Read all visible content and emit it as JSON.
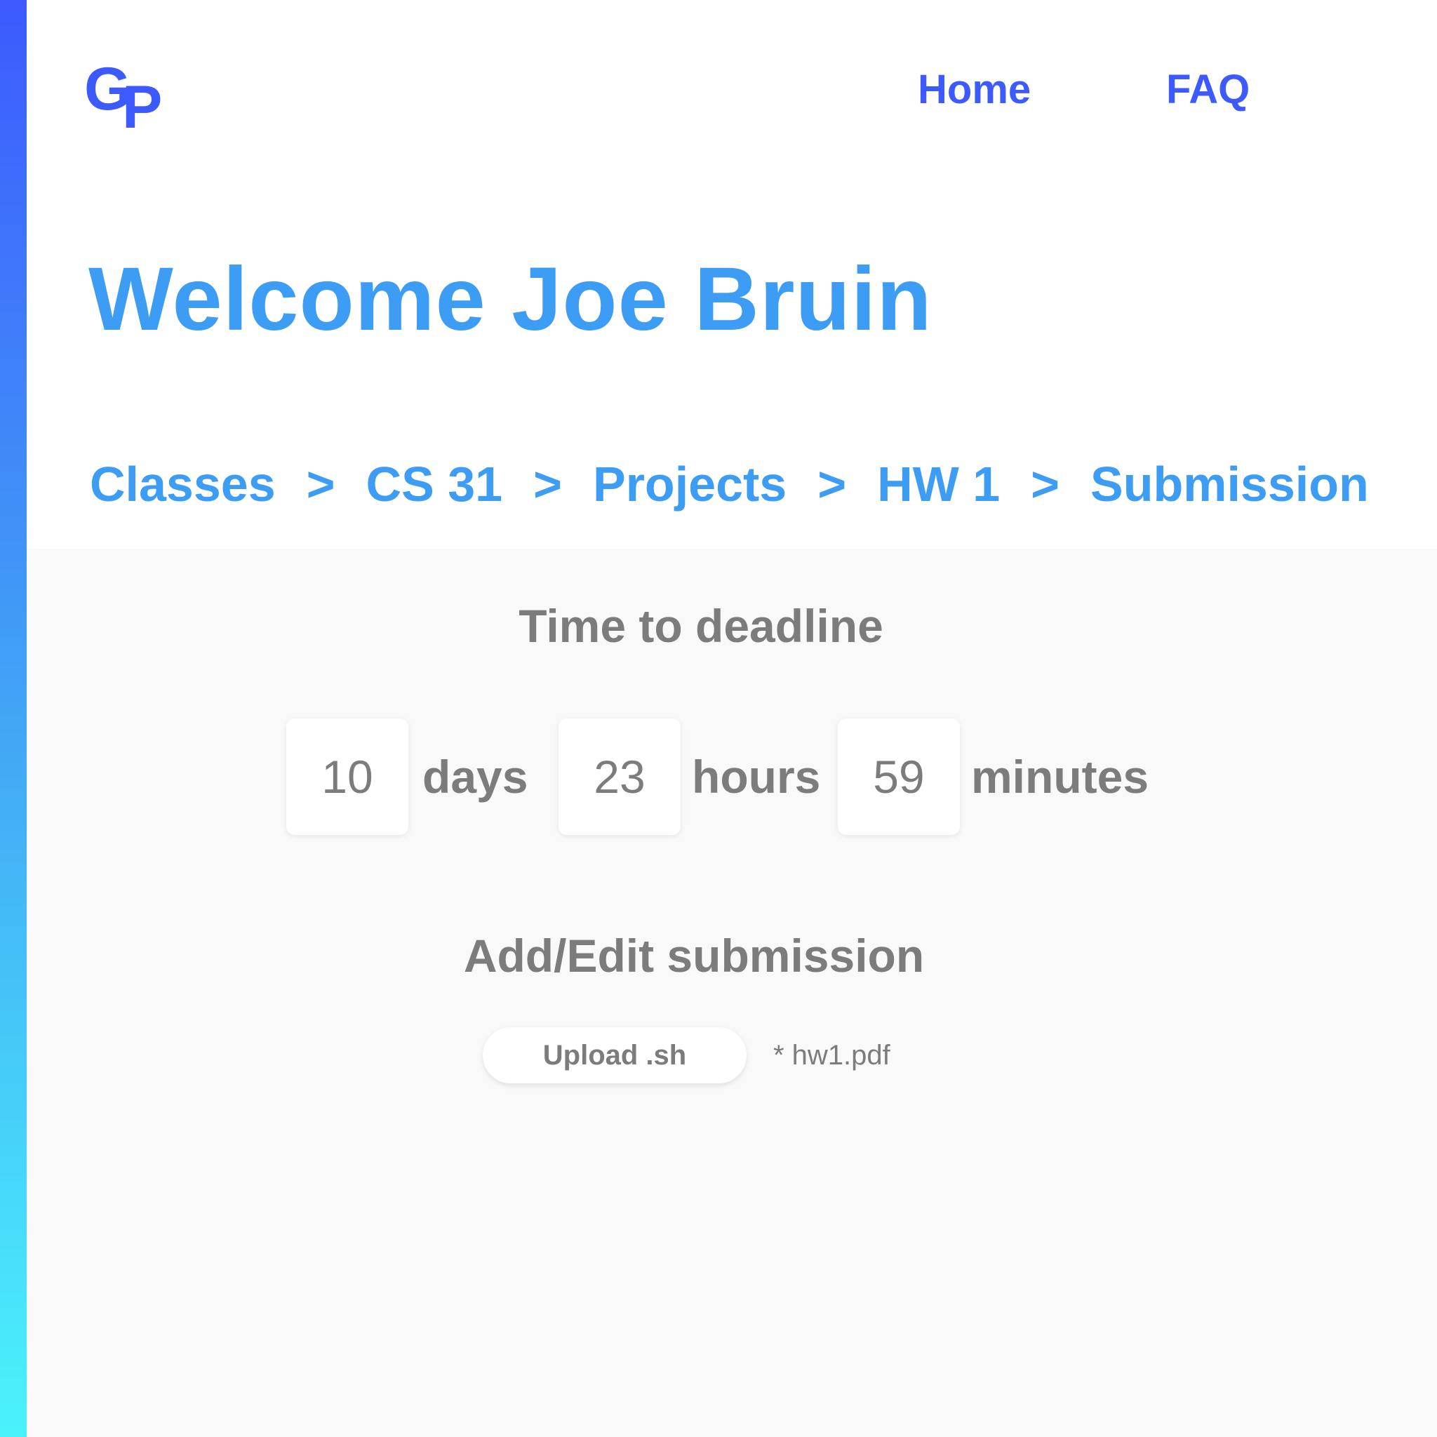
{
  "brand": {
    "logo_letter_1": "G",
    "logo_letter_2": "P",
    "color": "#3d5afe"
  },
  "nav": {
    "home": "Home",
    "faq": "FAQ"
  },
  "page": {
    "title": "Welcome Joe Bruin"
  },
  "breadcrumb": {
    "separator": ">",
    "items": [
      "Classes",
      "CS 31",
      "Projects",
      "HW 1",
      "Submission"
    ]
  },
  "deadline": {
    "title": "Time to deadline",
    "days": {
      "value": "10",
      "unit": "days"
    },
    "hours": {
      "value": "23",
      "unit": "hours"
    },
    "minutes": {
      "value": "59",
      "unit": "minutes"
    }
  },
  "submission": {
    "title": "Add/Edit submission",
    "upload_label": "Upload .sh",
    "file_name": "* hw1.pdf"
  },
  "colors": {
    "accent_gradient_top": "#3d5afe",
    "accent_gradient_bottom": "#4af3fc",
    "title_blue": "#3d9cf4",
    "text_gray": "#7c7c7c",
    "content_bg": "#f9f9f9"
  }
}
